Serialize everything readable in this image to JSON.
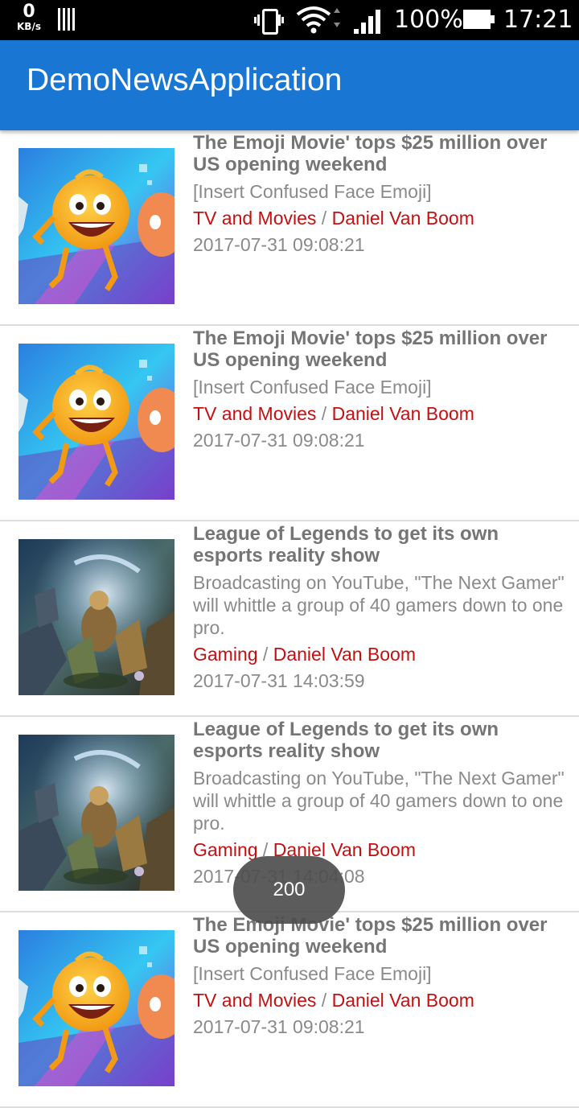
{
  "status_bar": {
    "net_speed": "0",
    "net_unit": "KB/s",
    "battery": "100%",
    "time": "17:21"
  },
  "app_bar": {
    "title": "DemoNewsApplication"
  },
  "colors": {
    "app_bar": "#1976d2",
    "link_red": "#c41010",
    "text_gray": "#757575"
  },
  "articles": [
    {
      "title": "The Emoji Movie' tops $25 million over US opening weekend",
      "description": "[Insert Confused Face Emoji]",
      "category": "TV and Movies",
      "separator": " / ",
      "author": "Daniel Van Boom",
      "date": "2017-07-31 09:08:21",
      "thumbnail": "emoji-movie"
    },
    {
      "title": "The Emoji Movie' tops $25 million over US opening weekend",
      "description": "[Insert Confused Face Emoji]",
      "category": "TV and Movies",
      "separator": " / ",
      "author": "Daniel Van Boom",
      "date": "2017-07-31 09:08:21",
      "thumbnail": "emoji-movie"
    },
    {
      "title": "League of Legends to get its own esports reality show",
      "description": "Broadcasting on YouTube, \"The Next Gamer\" will whittle a group of 40 gamers down to one pro.",
      "category": "Gaming",
      "separator": " / ",
      "author": "Daniel Van Boom",
      "date": "2017-07-31 14:03:59",
      "thumbnail": "league-of-legends"
    },
    {
      "title": "League of Legends to get its own esports reality show",
      "description": "Broadcasting on YouTube, \"The Next Gamer\" will whittle a group of 40 gamers down to one pro.",
      "category": "Gaming",
      "separator": " / ",
      "author": "Daniel Van Boom",
      "date": "2017-07-31 14:04:08",
      "thumbnail": "league-of-legends"
    },
    {
      "title": "The Emoji Movie' tops $25 million over US opening weekend",
      "description": "[Insert Confused Face Emoji]",
      "category": "TV and Movies",
      "separator": " / ",
      "author": "Daniel Van Boom",
      "date": "2017-07-31 09:08:21",
      "thumbnail": "emoji-movie"
    }
  ],
  "toast": {
    "text": "200"
  }
}
